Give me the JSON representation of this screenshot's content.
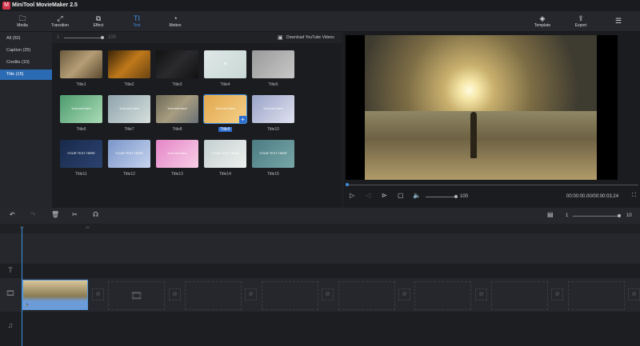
{
  "app": {
    "title": "MiniTool MovieMaker 2.5",
    "logo": "M"
  },
  "toolbar": {
    "items": [
      {
        "label": "Media",
        "icon": "🗀"
      },
      {
        "label": "Transition",
        "icon": "⤢"
      },
      {
        "label": "Effect",
        "icon": "⧉"
      },
      {
        "label": "Text",
        "icon": "TI"
      },
      {
        "label": "Motion",
        "icon": "◔"
      }
    ],
    "right": [
      {
        "label": "Template",
        "icon": "◈"
      },
      {
        "label": "Export",
        "icon": "⇪"
      }
    ],
    "menu_icon": "☰"
  },
  "categories": [
    {
      "label": "All  (50)"
    },
    {
      "label": "Caption  (25)"
    },
    {
      "label": "Credits  (10)"
    },
    {
      "label": "Title  (15)"
    }
  ],
  "size_slider": {
    "min": "1",
    "max": "100",
    "value": 100
  },
  "download_label": "Download YouTube Videos",
  "titles": [
    {
      "label": "Title1",
      "bg": "linear-gradient(135deg,#6b5a3e,#b59e76,#5c4a30)",
      "text": ""
    },
    {
      "label": "Title2",
      "bg": "linear-gradient(135deg,#3a2406,#c0791b,#6b4311)",
      "text": ""
    },
    {
      "label": "Title3",
      "bg": "linear-gradient(135deg,#111,#2b2b2e,#111)",
      "text": ""
    },
    {
      "label": "Title4",
      "bg": "linear-gradient(135deg,#dfe8e6,#c9d8d6)",
      "text": "✖"
    },
    {
      "label": "Title5",
      "bg": "linear-gradient(135deg,#9a9a9a,#c8c8c8)",
      "text": ""
    },
    {
      "label": "Title6",
      "bg": "linear-gradient(135deg,#4d9b6e,#aadcb6)",
      "text": "Your text here"
    },
    {
      "label": "Title7",
      "bg": "linear-gradient(135deg,#8fa3ad,#d6e0dc)",
      "text": "Your text here"
    },
    {
      "label": "Title8",
      "bg": "linear-gradient(135deg,#6e6a57,#a79c80,#6a7176)",
      "text": "Your text here"
    },
    {
      "label": "Title9",
      "bg": "linear-gradient(135deg,#e2a84e,#f4d08a)",
      "text": "Your text here"
    },
    {
      "label": "Title10",
      "bg": "linear-gradient(135deg,#9aa3c8,#e0e2ef)",
      "text": "Your text here"
    },
    {
      "label": "Title11",
      "bg": "linear-gradient(135deg,#18294a,#2c4370)",
      "text": "YOUR TEXT HERE"
    },
    {
      "label": "Title12",
      "bg": "linear-gradient(135deg,#7a95c9,#c6d4ef)",
      "text": "YOUR TEXT HERE"
    },
    {
      "label": "Title13",
      "bg": "linear-gradient(135deg,#e585c8,#f7cfe6)",
      "text": "Your text here"
    },
    {
      "label": "Title14",
      "bg": "linear-gradient(135deg,#c3cfcf,#eef1ef)",
      "text": "YOUR TEXT HERE"
    },
    {
      "label": "Title15",
      "bg": "linear-gradient(135deg,#4b7c82,#78a7a8)",
      "text": "YOUR TEXT HERE"
    }
  ],
  "selected_title": "Title9",
  "player": {
    "volume": "100",
    "time": "00:00:00.00/00:00:03.24",
    "progress": 0
  },
  "timeline": {
    "zoom_min": "1",
    "zoom_max": "10",
    "ruler": [
      "0s",
      "4s"
    ]
  },
  "colors": {
    "accent": "#3d8fe0",
    "selected": "#2b6bb4"
  }
}
